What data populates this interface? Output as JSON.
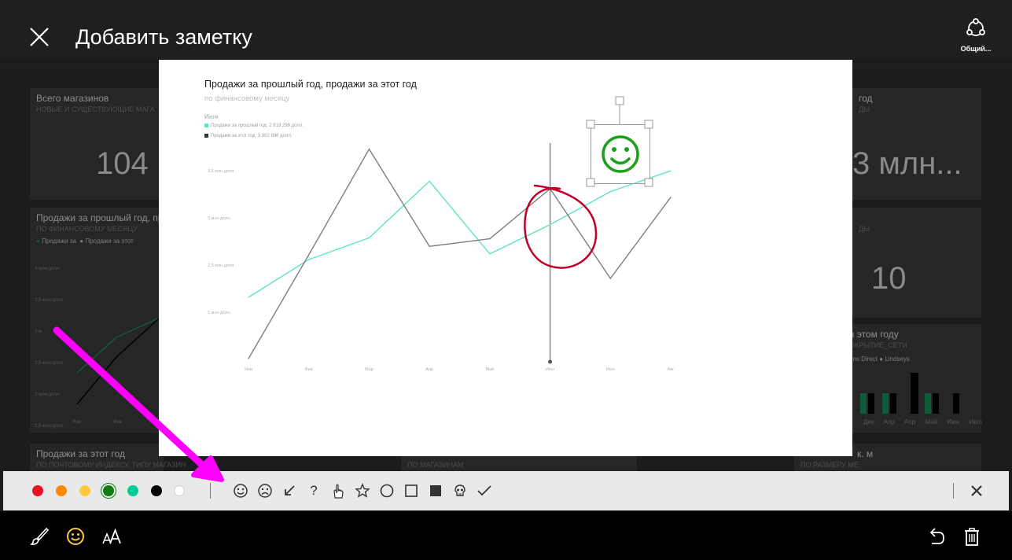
{
  "header": {
    "title": "Добавить заметку",
    "share_label": "Общий..."
  },
  "background": {
    "tile1": {
      "title": "Всего магазинов",
      "subtitle": "НОВЫЕ И СУЩЕСТВУЮЩИЕ МАГА",
      "value": "104"
    },
    "tile2": {
      "title": "Продажи за прошлый год, пр",
      "subtitle": "ПО ФИНАНСОВОМУ МЕСЯЦУ",
      "legend1": "Продажи за",
      "legend2": "Продажи за этот",
      "yticks": [
        "4 млн долл.",
        "3,5 млн долл.",
        "3 м",
        "2,5 млн долл.",
        "2 млн долл.",
        "1,5 млн долл."
      ],
      "xticks": [
        "Янв",
        "Фев"
      ]
    },
    "tile3": {
      "title": "Продажи за этот год",
      "subtitle": "ПО ПОЧТОВОМУ ИНДЕКСУ, ТИПУ МАГАЗИН"
    },
    "tile4": {
      "title": "год",
      "subtitle": "ДЫ",
      "value": "3 млн..."
    },
    "tile5": {
      "subtitle": "ДЫ",
      "value": "10"
    },
    "tile6": {
      "title": "в этом году",
      "subtitle": "ОКРЫТИЕ_СЕТИ",
      "legend1": "ons Direct",
      "legend2": "Lindseys",
      "xticks": [
        "Дек",
        "Апр",
        "Апр",
        "Май",
        "Июн",
        "Июл"
      ]
    },
    "tile7": {
      "title": "Продажи за этот г",
      "subtitle": "ПО МАГАЗИНАМ"
    },
    "tile8": {
      "title": "к. м",
      "subtitle": "ПО РАЗМЕРУ МЕ"
    }
  },
  "canvas_chart": {
    "title": "Продажи за прошлый год, продажи за этот год",
    "subtitle": "по финансовому месяцу",
    "legend_header": "Июн",
    "legend_items": [
      "Продажи за прошлый год: 2 918 298 долл.",
      "Продажи за этот год: 3 302 896 долл."
    ],
    "yticks": [
      "3,5 млн долл.",
      "3 млн долл.",
      "2,5 млн долл.",
      "2 млн долл."
    ],
    "xticks": [
      "Янв",
      "Фев",
      "Мар",
      "Апр",
      "Май",
      "Июн",
      "Июл",
      "Авг"
    ]
  },
  "chart_data": {
    "type": "line",
    "title": "Продажи за прошлый год, продажи за этот год",
    "categories": [
      "Янв",
      "Фев",
      "Мар",
      "Апр",
      "Май",
      "Июн",
      "Июл",
      "Авг"
    ],
    "series": [
      {
        "name": "Продажи за прошлый год",
        "color": "#5ee3c8",
        "values": [
          2.15,
          2.55,
          2.78,
          3.38,
          2.61,
          2.92,
          3.27,
          3.49
        ]
      },
      {
        "name": "Продажи за этот год",
        "color": "#7f7f7f",
        "values": [
          1.5,
          2.6,
          3.72,
          2.69,
          2.77,
          3.3,
          2.35,
          3.21
        ]
      }
    ],
    "ylim": [
      1.5,
      3.75
    ],
    "ylabel": "",
    "xlabel": ""
  },
  "toolbar": {
    "colors": [
      "#e81123",
      "#ff8c00",
      "#ffc83d",
      "#107c10",
      "#00cc99",
      "#000000",
      "#ffffff"
    ],
    "stamps": [
      "smile-face-icon",
      "sad-face-icon",
      "arrow-icon",
      "question-icon",
      "pointing-hand-icon",
      "star-icon",
      "circle-icon",
      "square-icon",
      "filled-square-icon",
      "skull-icon",
      "checkmark-icon"
    ],
    "question_glyph": "?"
  },
  "colors": {
    "accent_arrow": "#ff00ff",
    "annotation_red": "#c0002a",
    "smiley_green": "#1aa01a"
  }
}
